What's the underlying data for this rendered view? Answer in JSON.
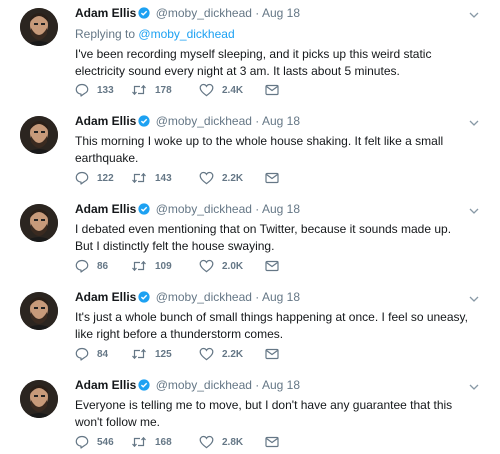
{
  "tweets": [
    {
      "name": "Adam Ellis",
      "handle": "@moby_dickhead",
      "separator": "·",
      "date": "Aug 18",
      "replying_prefix": "Replying to",
      "replying_to": "@moby_dickhead",
      "text": "I've been recording myself sleeping, and it picks up this weird static electricity sound every night at 3 am. It lasts about 5 minutes.",
      "replies": "133",
      "retweets": "178",
      "likes": "2.4K"
    },
    {
      "name": "Adam Ellis",
      "handle": "@moby_dickhead",
      "separator": "·",
      "date": "Aug 18",
      "text": "This morning I woke up to the whole house shaking. It felt like a small earthquake.",
      "replies": "122",
      "retweets": "143",
      "likes": "2.2K"
    },
    {
      "name": "Adam Ellis",
      "handle": "@moby_dickhead",
      "separator": "·",
      "date": "Aug 18",
      "text": "I debated even mentioning that on Twitter, because it sounds made up. But I distinctly felt the house swaying.",
      "replies": "86",
      "retweets": "109",
      "likes": "2.0K"
    },
    {
      "name": "Adam Ellis",
      "handle": "@moby_dickhead",
      "separator": "·",
      "date": "Aug 18",
      "text": "It's just a whole bunch of small things happening at once. I feel so uneasy, like right before a thunderstorm comes.",
      "replies": "84",
      "retweets": "125",
      "likes": "2.2K"
    },
    {
      "name": "Adam Ellis",
      "handle": "@moby_dickhead",
      "separator": "·",
      "date": "Aug 18",
      "text": "Everyone is telling me to move, but I don't have any guarantee that this won't follow me.",
      "replies": "546",
      "retweets": "168",
      "likes": "2.8K"
    }
  ],
  "colors": {
    "text": "#14171a",
    "secondary": "#657786",
    "link": "#1da1f2",
    "verified": "#1da1f2"
  },
  "icons": {
    "verified": "verified-badge-icon",
    "reply": "reply-icon",
    "retweet": "retweet-icon",
    "like": "heart-icon",
    "dm": "envelope-icon",
    "menu": "chevron-down-icon"
  }
}
